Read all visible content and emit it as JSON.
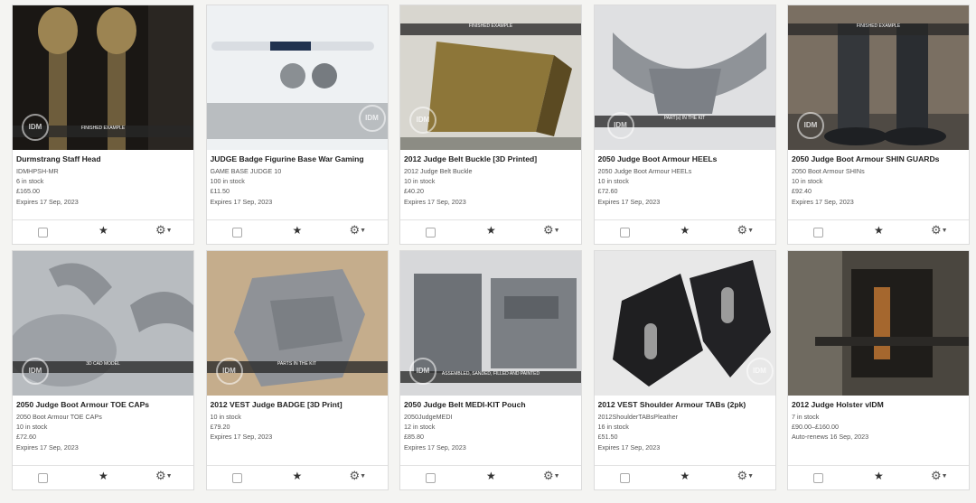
{
  "listings": [
    {
      "title": "Durmstrang Staff Head",
      "sku": "IDMHPSH-MR",
      "stock": "6 in stock",
      "price": "£165.00",
      "expires": "Expires 17 Sep, 2023",
      "banner": "FINISHED EXAMPLE",
      "stamp": "IDM"
    },
    {
      "title": "JUDGE Badge Figurine Base War Gaming",
      "sku": "GAME BASE JUDGE 10",
      "stock": "100 in stock",
      "price": "£11.50",
      "expires": "Expires 17 Sep, 2023",
      "banner": "",
      "stamp": "IDM"
    },
    {
      "title": "2012 Judge Belt Buckle [3D Printed]",
      "sku": "2012 Judge Belt Buckle",
      "stock": "10 in stock",
      "price": "£40.20",
      "expires": "Expires 17 Sep, 2023",
      "banner": "FINISHED EXAMPLE",
      "stamp": "IDM"
    },
    {
      "title": "2050 Judge Boot Armour HEELs",
      "sku": "2050 Judge Boot Armour HEELs",
      "stock": "10 in stock",
      "price": "£72.60",
      "expires": "Expires 17 Sep, 2023",
      "banner": "PART(s) IN THE KIT",
      "stamp": "IDM"
    },
    {
      "title": "2050 Judge Boot Armour SHIN GUARDs",
      "sku": "2050 Boot Armour SHINs",
      "stock": "10 in stock",
      "price": "£92.40",
      "expires": "Expires 17 Sep, 2023",
      "banner": "FINISHED EXAMPLE",
      "stamp": "IDM"
    },
    {
      "title": "2050 Judge Boot Armour TOE CAPs",
      "sku": "2050 Boot Armour TOE CAPs",
      "stock": "10 in stock",
      "price": "£72.60",
      "expires": "Expires 17 Sep, 2023",
      "banner": "3D CAD MODEL",
      "stamp": "IDM"
    },
    {
      "title": "2012 VEST Judge BADGE [3D Print]",
      "sku": "",
      "stock": "10 in stock",
      "price": "£79.20",
      "expires": "Expires 17 Sep, 2023",
      "banner": "PARTS IN THE KIT",
      "stamp": "IDM"
    },
    {
      "title": "2050 Judge Belt MEDI-KIT Pouch",
      "sku": "2050JudgeMEDI",
      "stock": "12 in stock",
      "price": "£85.80",
      "expires": "Expires 17 Sep, 2023",
      "banner": "ASSEMBLED, SANDED, FILLED AND PAINTED",
      "stamp": "IDM"
    },
    {
      "title": "2012 VEST Shoulder Armour TABs (2pk)",
      "sku": "2012ShoulderTABsPleather",
      "stock": "16 in stock",
      "price": "£51.50",
      "expires": "Expires 17 Sep, 2023",
      "banner": "",
      "stamp": "IDM"
    },
    {
      "title": "2012 Judge Holster vIDM",
      "sku": "",
      "stock": "7 in stock",
      "price": "£90.00–£160.00",
      "expires": "Auto-renews 16 Sep, 2023",
      "banner": "",
      "stamp": ""
    }
  ],
  "actions": {
    "star_icon": "star-icon",
    "gear_icon": "gear-icon"
  }
}
